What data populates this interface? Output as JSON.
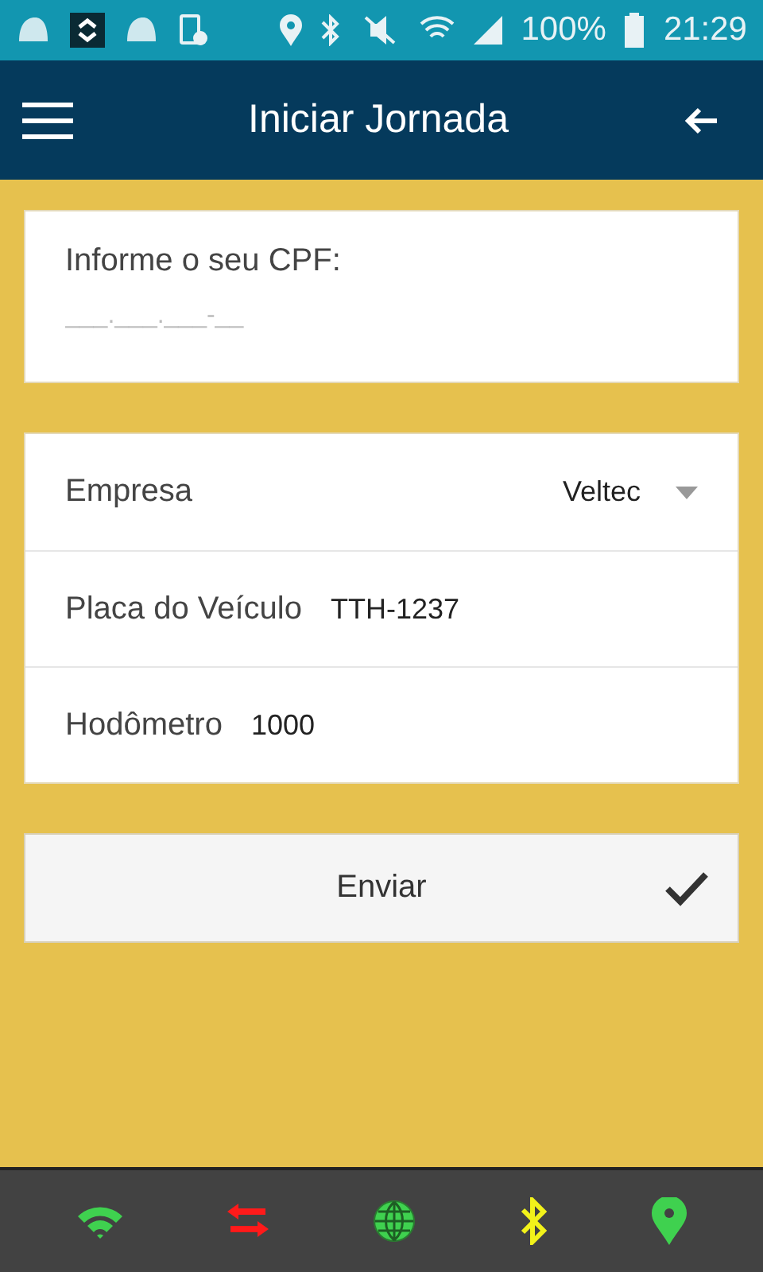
{
  "status_bar": {
    "battery": "100%",
    "time": "21:29"
  },
  "header": {
    "title": "Iniciar Jornada"
  },
  "cpf": {
    "label": "Informe o seu CPF:",
    "placeholder": "___.___.___-__"
  },
  "fields": [
    {
      "kind": "select",
      "label": "Empresa",
      "value": "Veltec"
    },
    {
      "kind": "text",
      "label": "Placa do Veículo",
      "value": "TTH-1237"
    },
    {
      "kind": "text",
      "label": "Hodômetro",
      "value": "1000"
    }
  ],
  "submit": {
    "label": "Enviar"
  },
  "bottom_icons": [
    {
      "kind": "wifi",
      "color": "#3fd14f"
    },
    {
      "kind": "transfer",
      "color": "#ff1a1a"
    },
    {
      "kind": "globe",
      "color": "#3fd14f"
    },
    {
      "kind": "bluetooth",
      "color": "#f2f21a"
    },
    {
      "kind": "location",
      "color": "#3fd14f"
    }
  ]
}
